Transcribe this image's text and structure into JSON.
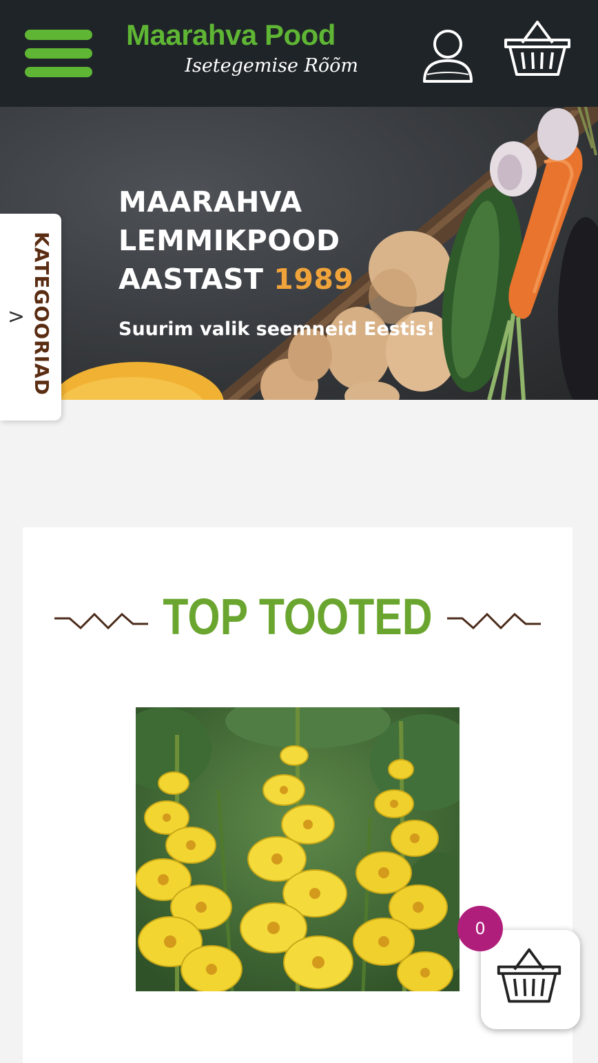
{
  "header": {
    "brand_name": "Maarahva Pood",
    "brand_tagline": "Isetegemise Rõõm",
    "menu_icon": "hamburger-menu-icon",
    "account_icon": "user-icon",
    "cart_icon": "shopping-basket-icon",
    "brand_color": "#5fb634",
    "background_color": "#1f2428"
  },
  "hero": {
    "title_line1": "MAARAHVA",
    "title_line2": "LEMMIKPOOD",
    "title_line3": "AASTAST",
    "title_year": "1989",
    "subtitle": "Suurim valik seemneid Eestis!",
    "accent_color": "#f0a33a"
  },
  "categories_tab": {
    "label": "KATEGOORIAD",
    "chevron": ">"
  },
  "main": {
    "section_title": "TOP TOOTED",
    "section_title_color": "#6aa52f",
    "product_image_icon": "yellow-gladiolus-product-image"
  },
  "floating_cart": {
    "count": "0",
    "badge_color": "#b01e7c",
    "icon": "shopping-basket-icon"
  }
}
